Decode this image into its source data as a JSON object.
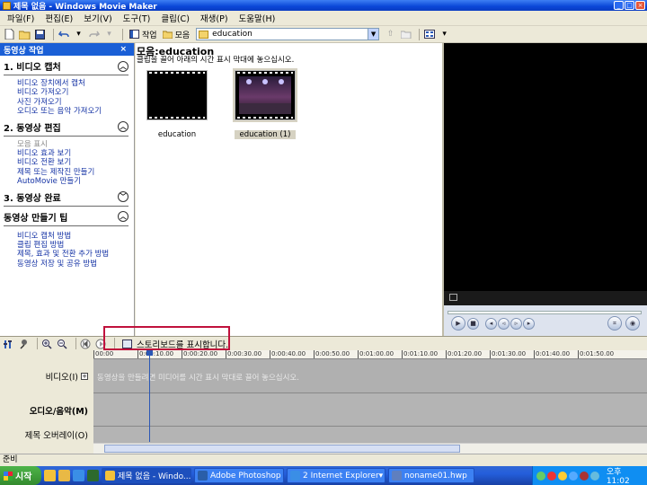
{
  "window": {
    "title": "제목 없음 - Windows Movie Maker"
  },
  "menu": [
    "파일(F)",
    "편집(E)",
    "보기(V)",
    "도구(T)",
    "클립(C)",
    "재생(P)",
    "도움말(H)"
  ],
  "toolbar": {
    "tasks_label": "작업",
    "collections_label": "모음",
    "collection_select_value": "education"
  },
  "taskpane": {
    "header": "동영상 작업",
    "close": "×",
    "sections": [
      {
        "title": "1. 비디오 캡처",
        "links": [
          "비디오 장치에서 캡처",
          "비디오 가져오기",
          "사진 가져오기",
          "오디오 또는 음악 가져오기"
        ]
      },
      {
        "title": "2. 동영상 편집",
        "links": [
          "모음 표시",
          "비디오 효과 보기",
          "비디오 전환 보기",
          "제목 또는 제작진 만들기",
          "AutoMovie 만들기"
        ]
      },
      {
        "title": "3. 동영상 완료",
        "links": []
      },
      {
        "title": "동영상 만들기 팁",
        "links": [
          "비디오 캡처 방법",
          "클립 편집 방법",
          "제목, 효과 및 전환 추가 방법",
          "동영상 저장 및 공유 방법"
        ]
      }
    ]
  },
  "collection": {
    "title": "모음:education",
    "hint": "클립을 끌어 아래의 시간 표시 막대에 놓으십시오.",
    "clips": [
      {
        "label": "education"
      },
      {
        "label": "education (1)"
      }
    ]
  },
  "timeline": {
    "storyboard_label": "스토리보드를 표시합니다.",
    "ruler": [
      "00:00",
      "0:00:10.00",
      "0:00:20.00",
      "0:00:30.00",
      "0:00:40.00",
      "0:00:50.00",
      "0:01:00.00",
      "0:01:10.00",
      "0:01:20.00",
      "0:01:30.00",
      "0:01:40.00",
      "0:01:50.00"
    ],
    "video_label": "비디오(I)",
    "video_expand": "+",
    "video_hint": "동영상을 만들려면 미디어를 시간 표시 막대로 끌어 놓으십시오.",
    "audio_label": "오디오/음악(M)",
    "overlay_label": "제목 오버레이(O)"
  },
  "status": {
    "text": "준비"
  },
  "taskbar": {
    "start": "시작",
    "buttons": [
      {
        "label": "제목 없음 - Windo...",
        "icon_color": "#f3c13a"
      },
      {
        "label": "Adobe Photoshop",
        "icon_color": "#2a5ea8"
      },
      {
        "label": "2 Internet Explorer",
        "icon_color": "#3a8ee6"
      },
      {
        "label": "noname01.hwp",
        "icon_color": "#5f7fbf"
      }
    ],
    "clock": "오후 11:02"
  },
  "colors": {
    "accent": "#1a5fd6",
    "highlight": "#c0113c"
  }
}
